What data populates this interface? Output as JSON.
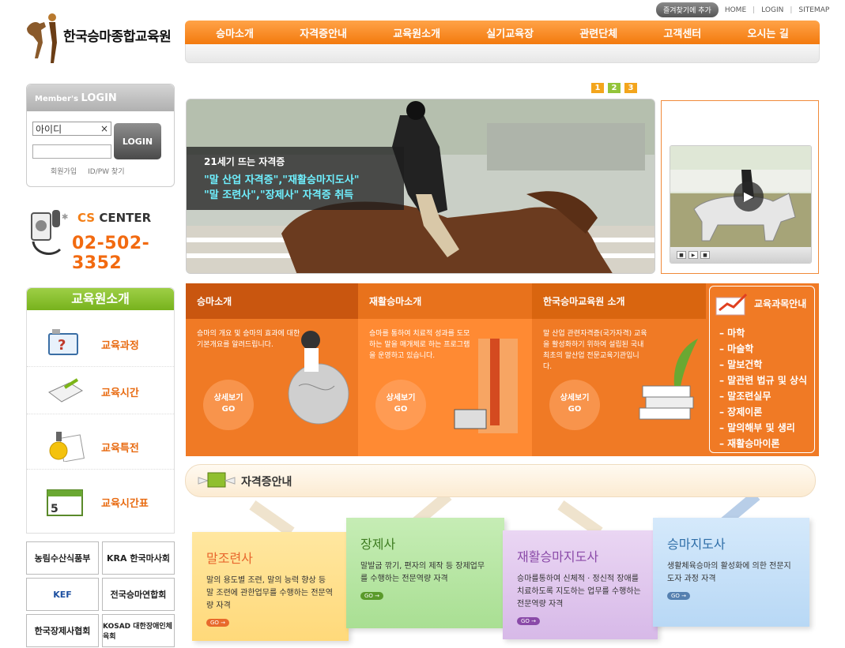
{
  "header": {
    "bookmark": "즐겨찾기에 추가",
    "home": "HOME",
    "login": "LOGIN",
    "sitemap": "SITEMAP",
    "sep": "|",
    "logo_text": "한국승마종합교육원"
  },
  "nav": [
    "승마소개",
    "자격증안내",
    "교육원소개",
    "실기교육장",
    "관련단체",
    "고객센터",
    "오시는 길"
  ],
  "login": {
    "head_small": "Member's",
    "head_big": "LOGIN",
    "id_value": "아이디",
    "clear": "×",
    "button": "LOGIN",
    "join": "회원가입",
    "find": "ID/PW 찾기"
  },
  "cs": {
    "title_cs": "CS",
    "title_center": "CENTER",
    "phone": "02-502-3352"
  },
  "edu": {
    "title": "교육원소개",
    "items": [
      "교육과정",
      "교육시간",
      "교육특전",
      "교육시간표"
    ]
  },
  "partners": [
    "농림수산식품부",
    "KRA 한국마사회",
    "KEF",
    "전국승마연합회",
    "한국장제사협회",
    "KOSAD 대한장애인체육회"
  ],
  "slider": {
    "pages": [
      "1",
      "2",
      "3"
    ],
    "cap1": "21세기 뜨는 자격증",
    "cap2": "\"말 산업 자격증\",\"재활승마지도사\"",
    "cap3": "\"말 조련사\",\"장제사\" 자격증 취득"
  },
  "video": {
    "play": "▶",
    "controls": [
      "■",
      "▶",
      "■"
    ]
  },
  "programs": [
    {
      "title": "승마소개",
      "desc": "승마의 개요 및 승마의 효과에 대한 기본개요를 알려드립니다.",
      "go1": "상세보기",
      "go2": "GO"
    },
    {
      "title": "재활승마소개",
      "desc": "승마를 통하여 치료적 성과를 도모하는 말을 매개체로 하는 프로그램을 운영하고 있습니다.",
      "go1": "상세보기",
      "go2": "GO"
    },
    {
      "title": "한국승마교육원 소개",
      "desc": "말 산업 관련자격증(국가자격) 교육을 활성화하기 위하여 설립된 국내 최초의 말산업 전문교육기관입니다.",
      "go1": "상세보기",
      "go2": "GO"
    }
  ],
  "course": {
    "title": "교육과목안내",
    "items": [
      "– 마학",
      "– 마술학",
      "– 말보건학",
      "– 말관련 법규 및 상식",
      "– 말조련실무",
      "– 장제이론",
      "– 말의해부 및 생리",
      "– 재활승마이론"
    ]
  },
  "cert": {
    "title": "자격증안내",
    "cards": [
      {
        "title": "말조련사",
        "desc": "말의 용도별 조련, 말의 능력 향상 등 말 조련에 관한업무를 수행하는 전문역량 자격",
        "go": "GO →"
      },
      {
        "title": "장제사",
        "desc": "말발굽 깎기, 편자의 제작 등 장제업무를 수행하는 전문역량 자격",
        "go": "GO →"
      },
      {
        "title": "재활승마지도사",
        "desc": "승마를통하여 신체적 · 정신적 장애를 치료하도록 지도하는 업무를 수행하는 전문역량 자격",
        "go": "GO →"
      },
      {
        "title": "승마지도사",
        "desc": "생활체육승마의 활성화에 의한 전문지도자 과정 자격",
        "go": "GO →"
      }
    ]
  },
  "colors": {
    "accent": "#f37a0e",
    "green": "#86bf2b",
    "program_bg": "#f07a25"
  }
}
